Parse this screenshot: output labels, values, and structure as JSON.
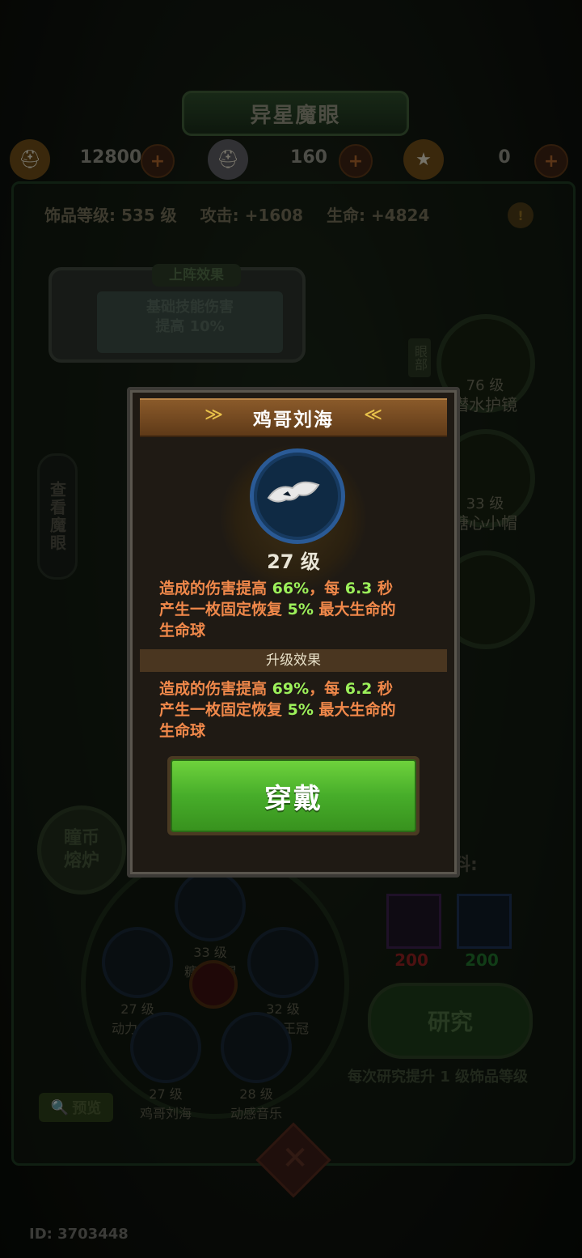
{
  "header": {
    "title": "异星魔眼"
  },
  "currencies": [
    {
      "icon": "gold-helmet-icon",
      "value": "12800"
    },
    {
      "icon": "silver-helmet-icon",
      "value": "160"
    },
    {
      "icon": "star-badge-icon",
      "value": "0"
    }
  ],
  "stats": {
    "level": "饰品等级: 535 级",
    "attack": "攻击: +1608",
    "hp": "生命: +4824"
  },
  "deploy": {
    "title": "上阵效果",
    "text_line1": "基础技能伤害",
    "text_line2": "提高 10%"
  },
  "side_tab": {
    "label": "查看魔眼"
  },
  "slots": {
    "eye_label": "眼部",
    "goggles": {
      "level": "76 级",
      "name": "潜水护镜"
    },
    "hat": {
      "level": "33 级",
      "name": "糖心小帽"
    }
  },
  "furnace": {
    "label_line1": "瞳币",
    "label_line2": "熔炉"
  },
  "wheel": [
    {
      "level": "33 级",
      "name": "糖心小帽"
    },
    {
      "level": "27 级",
      "name": "动力气罐"
    },
    {
      "level": "32 级",
      "name": "霸道王冠"
    },
    {
      "level": "27 级",
      "name": "鸡哥刘海"
    },
    {
      "level": "28 级",
      "name": "动感音乐"
    }
  ],
  "materials": {
    "label": "料:",
    "items": [
      {
        "icon": "silver-helmet-icon",
        "value": "200",
        "color": "#8c1f1f"
      },
      {
        "icon": "gold-helmet-icon",
        "value": "200",
        "color": "#1f6e2a"
      }
    ]
  },
  "research": {
    "label": "研究",
    "note": "每次研究提升 1 级饰品等级"
  },
  "preview": {
    "label": "预览"
  },
  "user": {
    "id": "ID: 3703448"
  },
  "modal": {
    "title": "鸡哥刘海",
    "level": "27 级",
    "current": {
      "line1_a": "造成的伤害提高 ",
      "line1_pct": "66%",
      "line1_b": "，每 ",
      "line1_sec": "6.3",
      "line1_c": " 秒",
      "line2_a": "产生一枚固定恢复 ",
      "line2_pct": "5%",
      "line2_b": " 最大生命的",
      "line3": "生命球"
    },
    "upgrade_header": "升级效果",
    "next": {
      "line1_a": "造成的伤害提高 ",
      "line1_pct": "69%",
      "line1_b": "，每 ",
      "line1_sec": "6.2",
      "line1_c": " 秒",
      "line2_a": "产生一枚固定恢复 ",
      "line2_pct": "5%",
      "line2_b": " 最大生命的",
      "line3": "生命球"
    },
    "equip_label": "穿戴"
  },
  "colors": {
    "accent_green": "#9cf05a",
    "text_orange": "#f0884a",
    "button_green": "#47ad2a"
  }
}
